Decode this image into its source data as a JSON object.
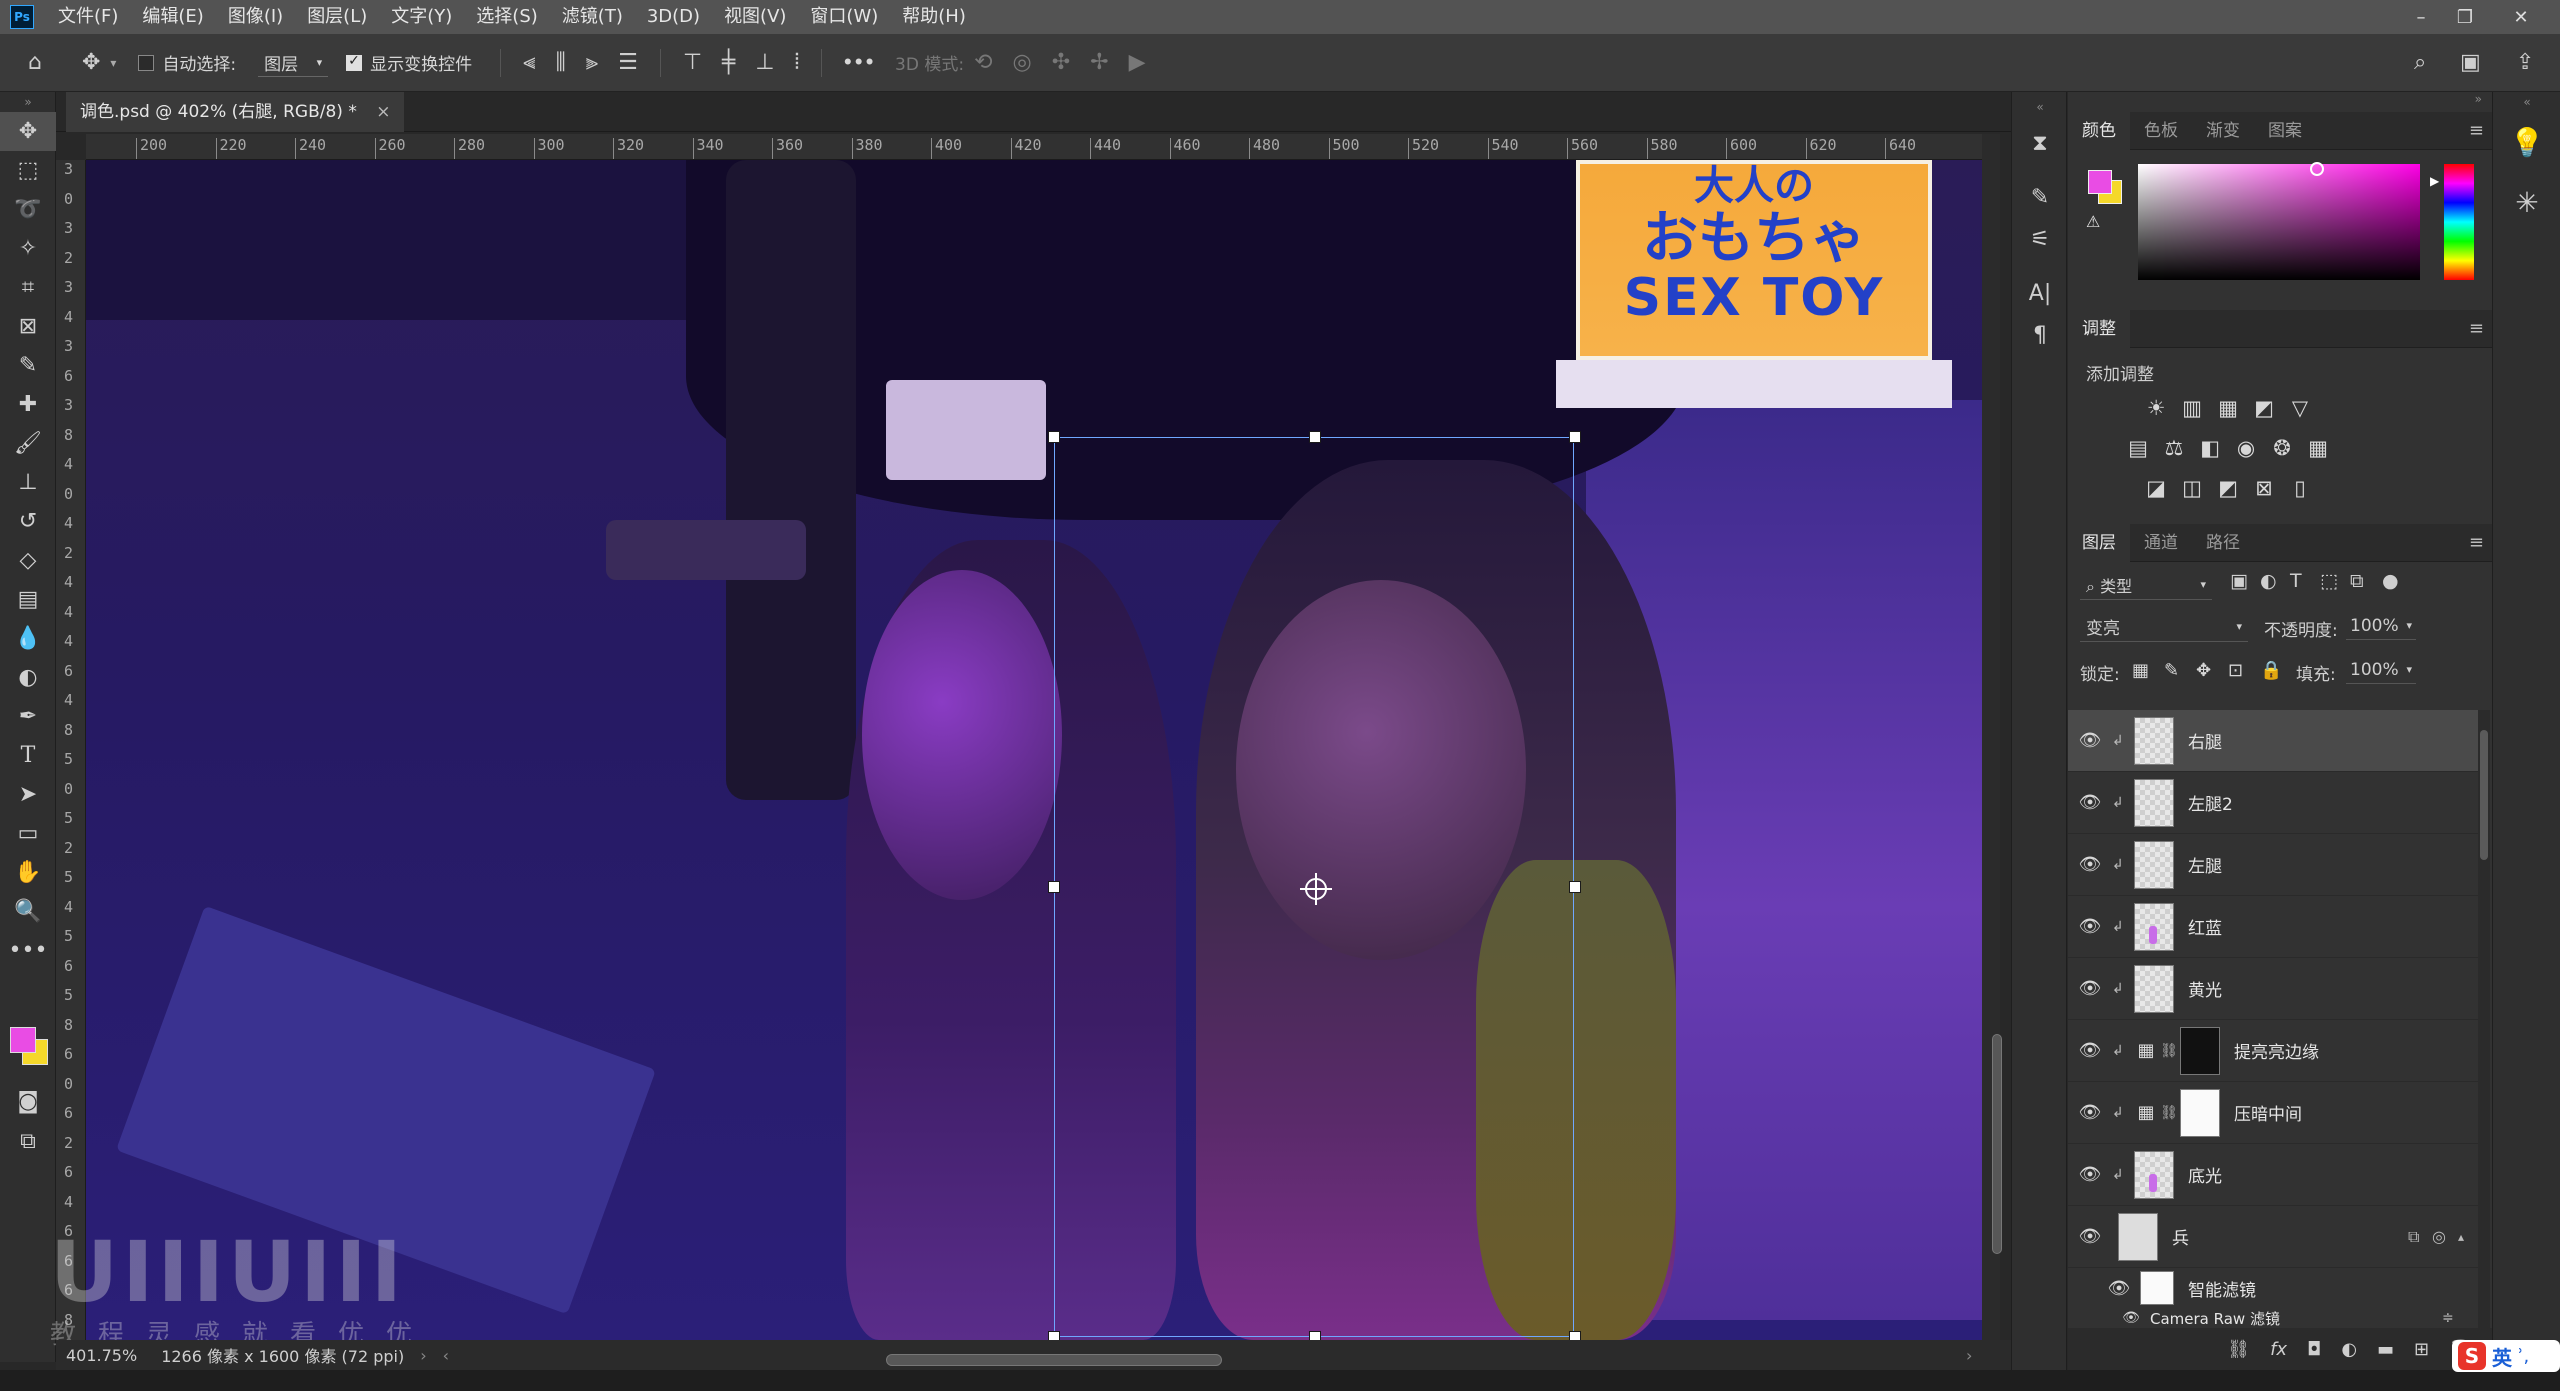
{
  "app": {
    "logo_text": "Ps",
    "menu": [
      "文件(F)",
      "编辑(E)",
      "图像(I)",
      "图层(L)",
      "文字(Y)",
      "选择(S)",
      "滤镜(T)",
      "3D(D)",
      "视图(V)",
      "窗口(W)",
      "帮助(H)"
    ]
  },
  "options_bar": {
    "auto_select_label": "自动选择:",
    "auto_select_checked": false,
    "target_value": "图层",
    "show_transform_label": "显示变换控件",
    "show_transform_checked": true,
    "more_label": "•••",
    "mode_3d_label": "3D 模式:"
  },
  "document": {
    "tab_title": "调色.psd @ 402% (右腿, RGB/8) *",
    "close_glyph": "×",
    "zoom": "401.75%",
    "doc_size": "1266 像素 x 1600 像素 (72 ppi)"
  },
  "rulers": {
    "h_ticks": [
      "200",
      "220",
      "240",
      "260",
      "280",
      "300",
      "320",
      "340",
      "360",
      "380",
      "400",
      "420",
      "440",
      "460",
      "480",
      "500",
      "520",
      "540",
      "560",
      "580",
      "600",
      "620",
      "640"
    ],
    "v_ticks": [
      "3",
      "0",
      "3",
      "2",
      "3",
      "4",
      "3",
      "6",
      "3",
      "8",
      "4",
      "0",
      "4",
      "2",
      "4",
      "4",
      "4",
      "6",
      "4",
      "8",
      "5",
      "0",
      "5",
      "2",
      "5",
      "4",
      "5",
      "6",
      "5",
      "8",
      "6",
      "0",
      "6",
      "2",
      "6",
      "4",
      "6",
      "6",
      "6",
      "8"
    ]
  },
  "canvas": {
    "sign_line1": "大人の",
    "sign_line2": "おもちゃ",
    "sign_line3": "SEX TOY"
  },
  "watermark": {
    "big": "UIIIUIII",
    "small": "教程灵感就看优优"
  },
  "color_panel": {
    "tabs": [
      "颜色",
      "色板",
      "渐变",
      "图案"
    ],
    "foreground": "#e94ce4",
    "background": "#f5d82a",
    "gamut_warning": "⚠"
  },
  "adjust_panel": {
    "tabs": [
      "调整"
    ],
    "subtitle": "添加调整",
    "row1": [
      "☀",
      "▥",
      "▦",
      "◩",
      "▽"
    ],
    "row2": [
      "▤",
      "⚖",
      "◧",
      "◉",
      "❂",
      "▦"
    ],
    "row3": [
      "◪",
      "◫",
      "◩",
      "⊠",
      "▯"
    ]
  },
  "layers_panel": {
    "tabs": [
      "图层",
      "通道",
      "路径"
    ],
    "filter_label": "类型",
    "blend_mode": "变亮",
    "opacity_label": "不透明度:",
    "opacity_value": "100%",
    "lock_label": "锁定:",
    "fill_label": "填充:",
    "fill_value": "100%",
    "layers": [
      {
        "name": "右腿",
        "type": "pixel",
        "selected": true
      },
      {
        "name": "左腿2",
        "type": "pixel"
      },
      {
        "name": "左腿",
        "type": "pixel"
      },
      {
        "name": "红蓝",
        "type": "pixel-mark"
      },
      {
        "name": "黄光",
        "type": "pixel"
      },
      {
        "name": "提亮亮边缘",
        "type": "curves-dark"
      },
      {
        "name": "压暗中间",
        "type": "curves-white"
      },
      {
        "name": "底光",
        "type": "pixel-mark"
      },
      {
        "name": "兵",
        "type": "smart"
      },
      {
        "name": "智能滤镜",
        "type": "filter-mask"
      },
      {
        "name": "Camera Raw 滤镜",
        "type": "filter"
      }
    ]
  },
  "ime": {
    "logo": "S",
    "lang": "英",
    "punct": "ʾ,"
  }
}
